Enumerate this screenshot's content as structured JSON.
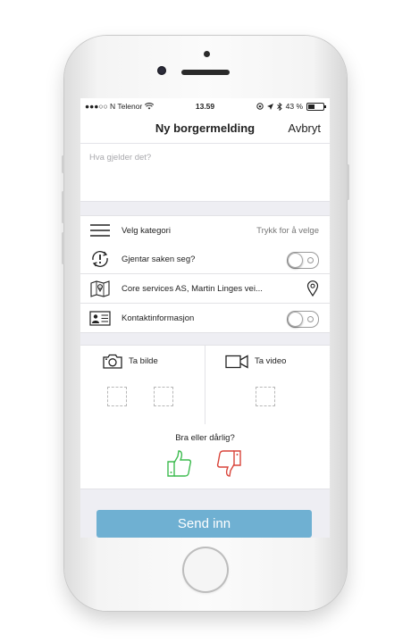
{
  "status_bar": {
    "carrier": "●●●○○ N Telenor",
    "time": "13.59",
    "battery_text": "43 %",
    "battery_level": 0.43
  },
  "nav": {
    "title": "Ny borgermelding",
    "cancel_label": "Avbryt"
  },
  "description": {
    "placeholder": "Hva gjelder det?"
  },
  "rows": {
    "category": {
      "label": "Velg kategori",
      "value": "Trykk for å velge",
      "icon": "list-icon"
    },
    "repeat": {
      "label": "Gjentar saken seg?",
      "icon": "repeat-alert-icon",
      "on": false
    },
    "location": {
      "label": "Core services AS, Martin Linges vei...",
      "icon": "map-icon"
    },
    "contact": {
      "label": "Kontaktinformasjon",
      "icon": "contact-card-icon",
      "on": false
    }
  },
  "media": {
    "photo_label": "Ta bilde",
    "video_label": "Ta video"
  },
  "rating": {
    "question": "Bra eller dårlig?",
    "good_color": "#3dbb4f",
    "bad_color": "#d9443a"
  },
  "submit_label": "Send inn",
  "colors": {
    "accent": "#6fb0d2"
  }
}
